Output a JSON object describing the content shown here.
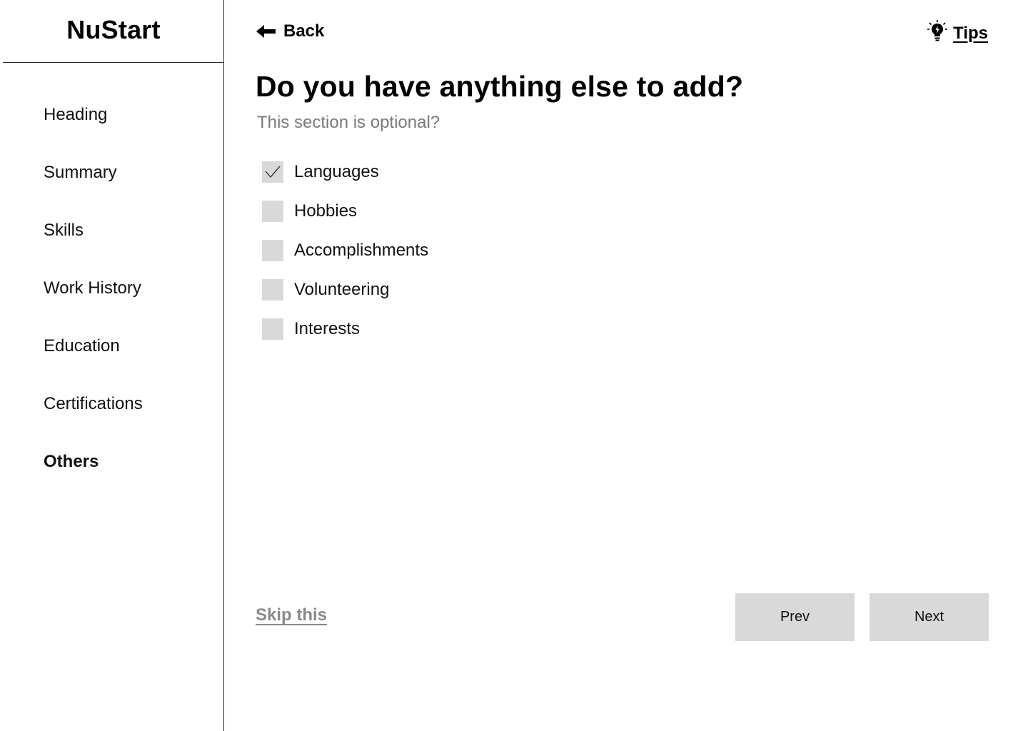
{
  "app": {
    "brand": "NuStart"
  },
  "sidebar": {
    "items": [
      {
        "label": "Heading",
        "active": false
      },
      {
        "label": "Summary",
        "active": false
      },
      {
        "label": "Skills",
        "active": false
      },
      {
        "label": "Work History",
        "active": false
      },
      {
        "label": "Education",
        "active": false
      },
      {
        "label": "Certifications",
        "active": false
      },
      {
        "label": "Others",
        "active": true
      }
    ]
  },
  "header": {
    "back_label": "Back",
    "tips_label": "Tips",
    "back_icon": "arrow-left-icon",
    "tips_icon": "lightbulb-icon"
  },
  "main": {
    "title": "Do you have anything else to add?",
    "subtitle": "This section is optional?",
    "options": [
      {
        "label": "Languages",
        "checked": true
      },
      {
        "label": "Hobbies",
        "checked": false
      },
      {
        "label": "Accomplishments",
        "checked": false
      },
      {
        "label": "Volunteering",
        "checked": false
      },
      {
        "label": "Interests",
        "checked": false
      }
    ]
  },
  "footer": {
    "skip_label": "Skip this",
    "prev_label": "Prev",
    "next_label": "Next"
  },
  "colors": {
    "checkbox_bg": "#d9d9d9",
    "button_bg": "#d9d9d9",
    "muted_text": "#7a7a7a",
    "divider": "#2b2b2b"
  }
}
